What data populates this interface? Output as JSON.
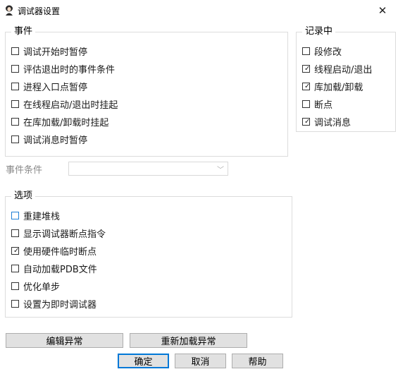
{
  "window": {
    "title": "调试器设置",
    "close_glyph": "✕"
  },
  "events_group": {
    "legend": "事件",
    "items": [
      {
        "label": "调试开始时暂停",
        "checked": false
      },
      {
        "label": "评估退出时的事件条件",
        "checked": false
      },
      {
        "label": "进程入口点暂停",
        "checked": false
      },
      {
        "label": "在线程启动/退出时挂起",
        "checked": false
      },
      {
        "label": "在库加载/卸载时挂起",
        "checked": false
      },
      {
        "label": "调试消息时暂停",
        "checked": false
      }
    ]
  },
  "record_group": {
    "legend": "记录中",
    "items": [
      {
        "label": "段修改",
        "checked": false
      },
      {
        "label": "线程启动/退出",
        "checked": true
      },
      {
        "label": "库加载/卸载",
        "checked": true
      },
      {
        "label": "断点",
        "checked": false
      },
      {
        "label": "调试消息",
        "checked": true
      }
    ]
  },
  "event_condition": {
    "label": "事件条件",
    "value": ""
  },
  "options_group": {
    "legend": "选项",
    "items": [
      {
        "label": "重建堆栈",
        "checked": false,
        "focused": true
      },
      {
        "label": "显示调试器断点指令",
        "checked": false
      },
      {
        "label": "使用硬件临时断点",
        "checked": true
      },
      {
        "label": "自动加载PDB文件",
        "checked": false
      },
      {
        "label": "优化单步",
        "checked": false
      },
      {
        "label": "设置为即时调试器",
        "checked": false
      }
    ]
  },
  "buttons": {
    "edit_exceptions": "编辑异常",
    "reload_exceptions": "重新加载异常",
    "ok": "确定",
    "cancel": "取消",
    "help": "帮助"
  },
  "icons": {
    "app": "app-icon",
    "close": "close-icon",
    "check": "✓",
    "dropdown": "chevron-down-icon"
  },
  "colors": {
    "focus_border": "#1f7fd6",
    "default_button_border": "#0078d7",
    "button_face": "#e1e1e1",
    "group_border": "#dcdcdc"
  }
}
